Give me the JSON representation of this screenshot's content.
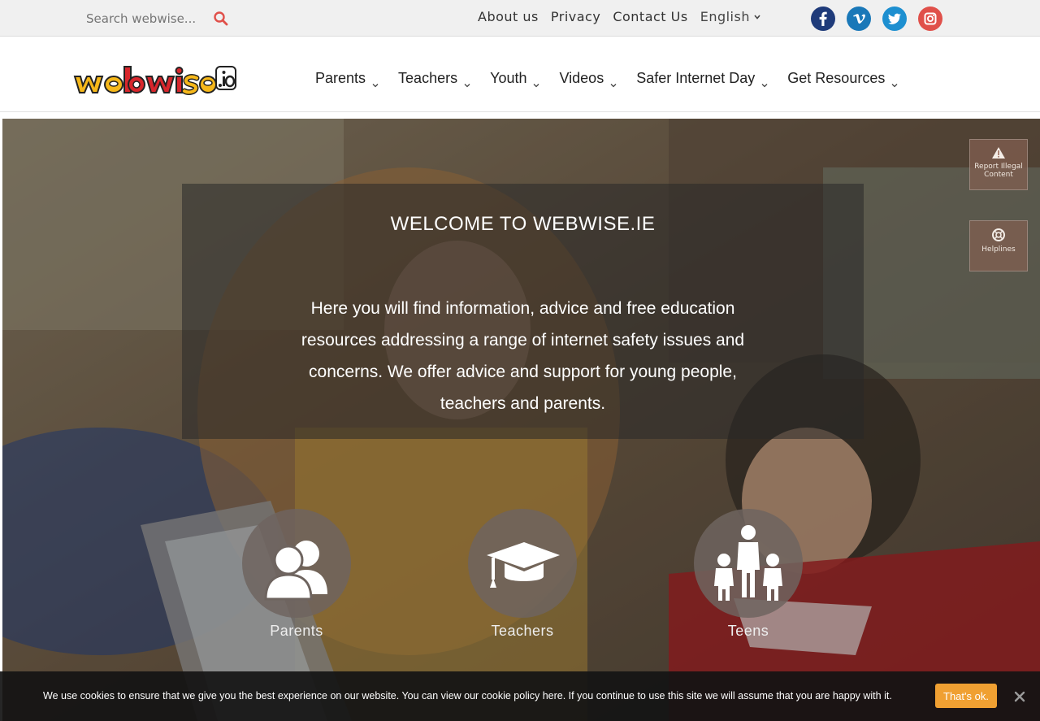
{
  "search": {
    "placeholder": "Search webwise..."
  },
  "toplinks": [
    {
      "label": "About us"
    },
    {
      "label": "Privacy"
    },
    {
      "label": "Contact Us"
    }
  ],
  "language": {
    "selected": "English"
  },
  "social": [
    {
      "name": "facebook-icon",
      "glyph": "f",
      "color": "#1f3b7a"
    },
    {
      "name": "vimeo-icon",
      "glyph": "v",
      "color": "#1a78b8"
    },
    {
      "name": "twitter-icon",
      "glyph": "t",
      "color": "#1d8fd0"
    },
    {
      "name": "instagram-icon",
      "glyph": "ig",
      "color": "#e0504a"
    }
  ],
  "nav": [
    {
      "label": "Parents"
    },
    {
      "label": "Teachers"
    },
    {
      "label": "Youth"
    },
    {
      "label": "Videos"
    },
    {
      "label": "Safer Internet Day"
    },
    {
      "label": "Get Resources"
    }
  ],
  "hero": {
    "title": "WELCOME TO WEBWISE.IE",
    "body": "Here you will find information, advice and free education resources addressing a range of internet safety issues and concerns. We offer advice and support for young people, teachers and parents."
  },
  "audiences": [
    {
      "label": "Parents",
      "icon": "parents-icon"
    },
    {
      "label": "Teachers",
      "icon": "graduation-cap-icon"
    },
    {
      "label": "Teens",
      "icon": "teens-icon"
    }
  ],
  "side_buttons": {
    "report": "Report Illegal Content",
    "helplines": "Helplines"
  },
  "cookie": {
    "text": "We use cookies to ensure that we give you the best experience on our website. You can view our cookie policy here. If you continue to use this site we will assume that you are happy with it.",
    "ok": "That's ok."
  },
  "colors": {
    "accent": "#f0a032",
    "logo_red": "#d8262c",
    "logo_yellow": "#f6b81a"
  }
}
